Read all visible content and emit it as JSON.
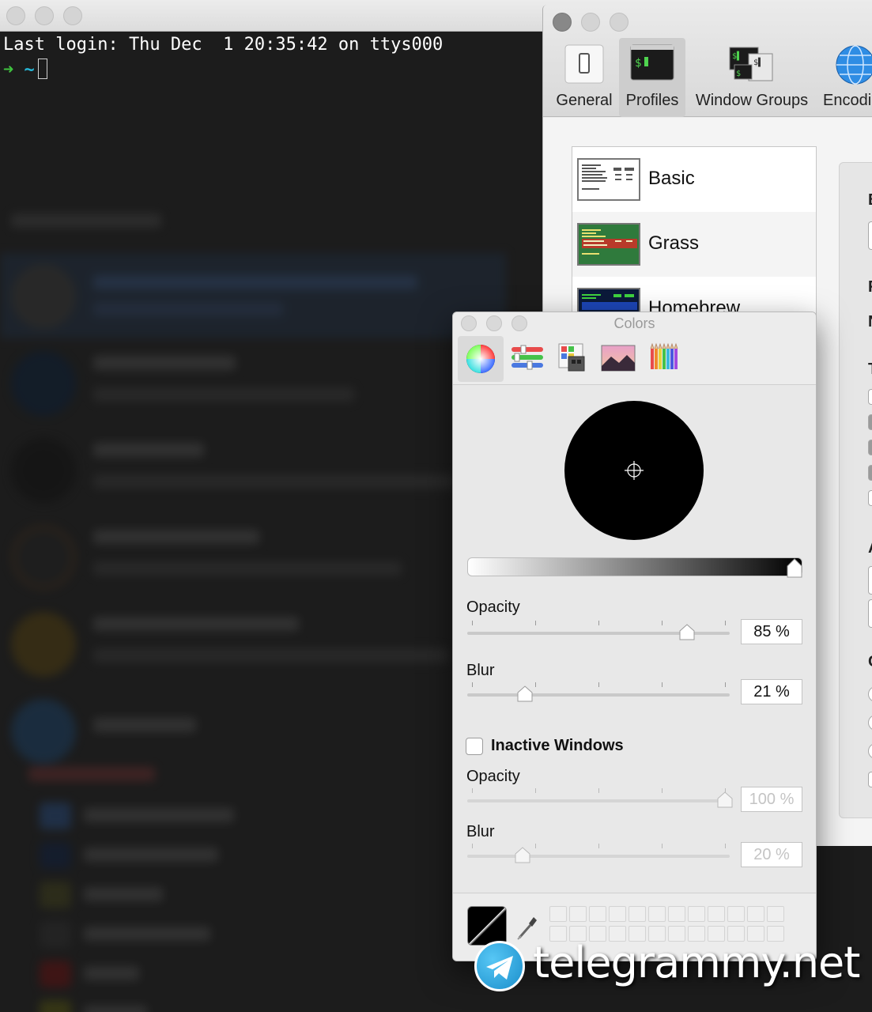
{
  "terminal": {
    "login_line": "Last login: Thu Dec  1 20:35:42 on ttys000",
    "prompt_arrow": "➜",
    "prompt_dir": "~"
  },
  "preferences": {
    "toolbar": [
      {
        "label": "General",
        "icon": "general-switch-icon"
      },
      {
        "label": "Profiles",
        "icon": "terminal-profile-icon",
        "selected": true
      },
      {
        "label": "Window Groups",
        "icon": "window-groups-icon"
      },
      {
        "label": "Encodi",
        "icon": "globe-icon"
      }
    ],
    "profiles": [
      {
        "name": "Basic",
        "thumb_bg": "#ffffff"
      },
      {
        "name": "Grass",
        "thumb_bg": "#2f7a3c"
      },
      {
        "name": "Homebrew",
        "thumb_bg": "#0b1a3a"
      }
    ],
    "right_panel_letters": [
      "B",
      "F",
      "N",
      "T",
      "A",
      "C"
    ]
  },
  "colors_panel": {
    "title": "Colors",
    "modes": [
      "color-wheel-icon",
      "color-sliders-icon",
      "color-palettes-icon",
      "image-palettes-icon",
      "pencils-icon"
    ],
    "selected_mode": 0,
    "current_color": "#000000",
    "opacity": {
      "label": "Opacity",
      "value": 85,
      "display": "85 %"
    },
    "blur": {
      "label": "Blur",
      "value": 21,
      "display": "21 %"
    },
    "inactive_windows": {
      "label": "Inactive Windows",
      "checked": false,
      "opacity": {
        "label": "Opacity",
        "value": 100,
        "display": "100 %"
      },
      "blur": {
        "label": "Blur",
        "value": 20,
        "display": "20 %"
      }
    }
  },
  "watermark": {
    "text": "telegrammy.net"
  }
}
